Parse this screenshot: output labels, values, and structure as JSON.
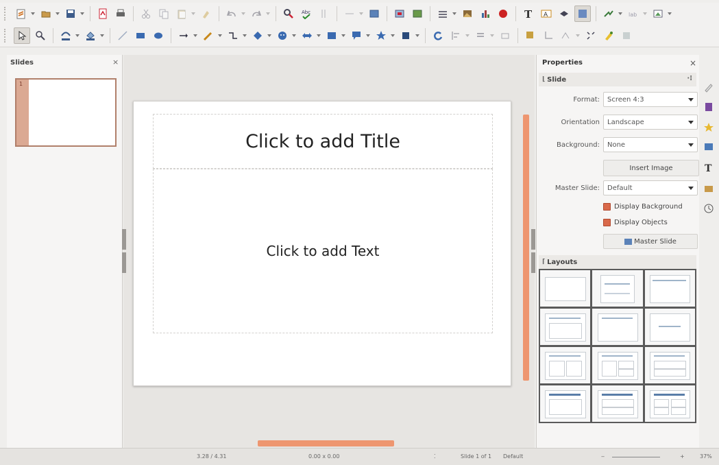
{
  "panes": {
    "slides_title": "Slides",
    "close_glyph": "×"
  },
  "slide": {
    "number": "1",
    "title_placeholder": "Click to add Title",
    "body_placeholder": "Click to add Text"
  },
  "sidebar": {
    "title": "Properties",
    "close_glyph": "×",
    "menu_glyph": "▾",
    "slide_section": "Slide",
    "format_label": "Format:",
    "format_value": "Screen 4:3",
    "orientation_label": "Orientation",
    "orientation_value": "Landscape",
    "background_label": "Background:",
    "background_value": "None",
    "insert_image": "Insert Image",
    "master_slide_label": "Master Slide:",
    "master_slide_value": "Default",
    "display_background": "Display Background",
    "display_objects": "Display Objects",
    "master_slide_button": "Master Slide",
    "layouts_section": "Layouts"
  },
  "status": {
    "position": "3.28 / 4.31",
    "size": "0.00 x 0.00",
    "slide": "Slide 1 of 1",
    "master": "Default",
    "zoom": "37%"
  },
  "colors": {
    "accent": "#ee9670",
    "check": "#d9694a",
    "thumb_strip": "#dba993"
  }
}
